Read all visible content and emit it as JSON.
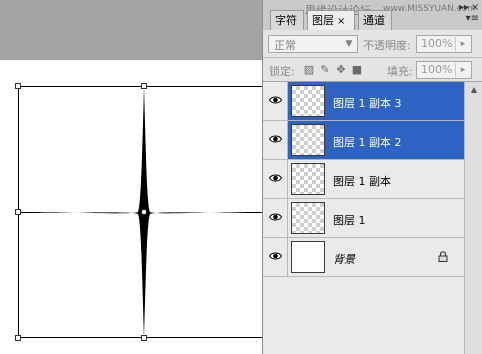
{
  "panel": {
    "tabs": [
      {
        "label": "字符",
        "active": false
      },
      {
        "label": "图层",
        "active": true,
        "close": "×"
      },
      {
        "label": "通道",
        "active": false
      }
    ],
    "watermark": "思缘设计论坛",
    "watermark_url": "www.MISSYUAN.com",
    "window_buttons": [
      "▸▸",
      "×"
    ],
    "menu_icon": "▾≡",
    "blend_mode": "正常",
    "opacity_label": "不透明度:",
    "opacity_value": "100%",
    "lock_label": "锁定:",
    "lock_icons": [
      "transparency-lock-icon",
      "brush-lock-icon",
      "move-lock-icon",
      "padlock-icon"
    ],
    "fill_label": "填充:",
    "fill_value": "100%"
  },
  "layers": [
    {
      "name": "图层 1 副本 3",
      "selected": true,
      "thumb": "transparent"
    },
    {
      "name": "图层 1 副本 2",
      "selected": true,
      "thumb": "transparent"
    },
    {
      "name": "图层 1 副本",
      "selected": false,
      "thumb": "transparent"
    },
    {
      "name": "图层 1",
      "selected": false,
      "thumb": "transparent"
    },
    {
      "name": "背景",
      "selected": false,
      "thumb": "white",
      "locked": true
    }
  ],
  "colors": {
    "selection_blue": "#2d64c4",
    "canvas_gray": "#a3a3a3",
    "panel_bg": "#e2e2e2"
  }
}
